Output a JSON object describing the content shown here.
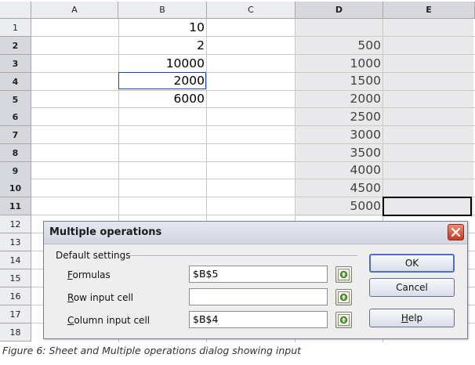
{
  "sheet": {
    "columns": [
      "A",
      "B",
      "C",
      "D",
      "E"
    ],
    "rows": [
      "1",
      "2",
      "3",
      "4",
      "5",
      "6",
      "7",
      "8",
      "9",
      "10",
      "11",
      "12",
      "13",
      "14",
      "15",
      "16",
      "17",
      "18"
    ],
    "col_b": [
      "10",
      "2",
      "10000",
      "2000",
      "6000"
    ],
    "col_d": [
      "500",
      "1000",
      "1500",
      "2000",
      "2500",
      "3000",
      "3500",
      "4000",
      "4500",
      "5000"
    ]
  },
  "dialog": {
    "title": "Multiple operations",
    "group_label": "Default settings",
    "fields": [
      {
        "label": "Formulas",
        "mnemonic": "F",
        "rest": "ormulas",
        "value": "$B$5"
      },
      {
        "label": "Row input cell",
        "mnemonic": "R",
        "rest": "ow input cell",
        "value": ""
      },
      {
        "label": "Column input cell",
        "mnemonic": "C",
        "rest": "olumn input cell",
        "value": "$B$4"
      }
    ],
    "buttons": {
      "ok": "OK",
      "cancel": "Cancel",
      "help_mnemonic": "H",
      "help_rest": "elp"
    }
  },
  "caption": "Figure 6: Sheet and Multiple operations dialog showing input",
  "colors": {
    "header_bg": "#ecedf1",
    "selected_header_bg": "#d6d8de",
    "selection_border": "#1f3fb3",
    "close_button": "#c73c24"
  }
}
